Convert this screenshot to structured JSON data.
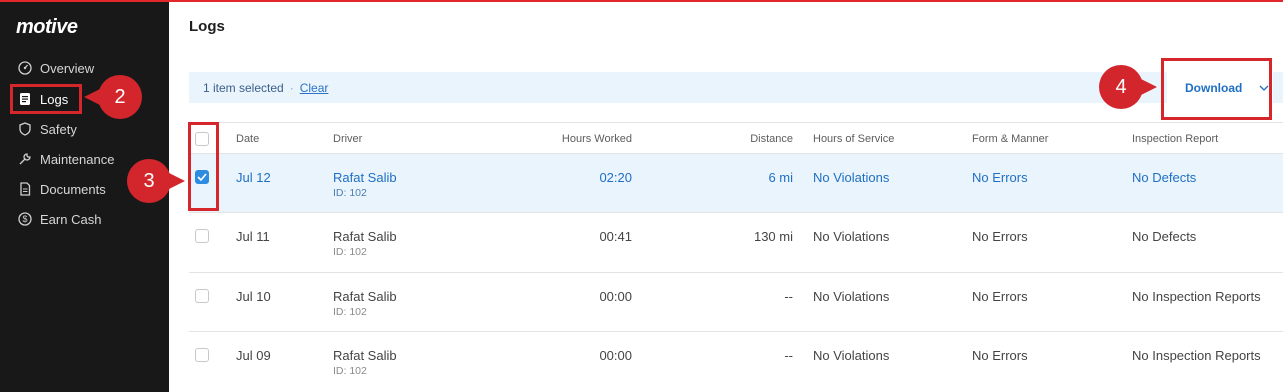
{
  "brand": {
    "logo": "motive",
    "accent": "#e3262c"
  },
  "sidebar": {
    "items": [
      {
        "label": "Overview",
        "icon": "overview-icon"
      },
      {
        "label": "Logs",
        "icon": "logs-icon",
        "active": true
      },
      {
        "label": "Safety",
        "icon": "shield-icon"
      },
      {
        "label": "Maintenance",
        "icon": "wrench-icon"
      },
      {
        "label": "Documents",
        "icon": "document-icon"
      },
      {
        "label": "Earn Cash",
        "icon": "dollar-icon"
      }
    ]
  },
  "callouts": [
    "2",
    "3",
    "4"
  ],
  "main": {
    "title": "Logs",
    "selection": {
      "text": "1 item selected",
      "separator": "·",
      "clear": "Clear"
    },
    "download_label": "Download"
  },
  "table": {
    "headers": [
      "Date",
      "Driver",
      "Hours Worked",
      "Distance",
      "Hours of Service",
      "Form & Manner",
      "Inspection Report"
    ],
    "rows": [
      {
        "date": "Jul 12",
        "driver": "Rafat Salib",
        "driver_id": "ID: 102",
        "hours": "02:20",
        "distance": "6 mi",
        "hos": "No Violations",
        "form": "No Errors",
        "inspection": "No Defects",
        "selected": true
      },
      {
        "date": "Jul 11",
        "driver": "Rafat Salib",
        "driver_id": "ID: 102",
        "hours": "00:41",
        "distance": "130 mi",
        "hos": "No Violations",
        "form": "No Errors",
        "inspection": "No Defects",
        "selected": false
      },
      {
        "date": "Jul 10",
        "driver": "Rafat Salib",
        "driver_id": "ID: 102",
        "hours": "00:00",
        "distance": "--",
        "hos": "No Violations",
        "form": "No Errors",
        "inspection": "No Inspection Reports",
        "selected": false
      },
      {
        "date": "Jul 09",
        "driver": "Rafat Salib",
        "driver_id": "ID: 102",
        "hours": "00:00",
        "distance": "--",
        "hos": "No Violations",
        "form": "No Errors",
        "inspection": "No Inspection Reports",
        "selected": false
      }
    ]
  }
}
